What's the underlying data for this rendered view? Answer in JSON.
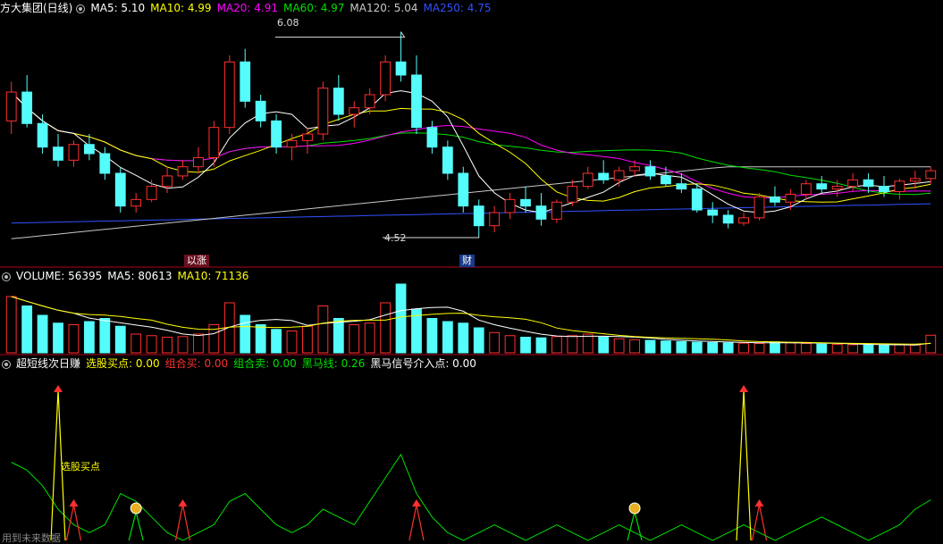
{
  "colors": {
    "bg": "#000000",
    "up": "#ff3030",
    "down": "#54fcfc",
    "ma5": "#ffffff",
    "ma10": "#ffff00",
    "ma20": "#ff00ff",
    "ma60": "#00e000",
    "ma120": "#c8c8c8",
    "ma250": "#3050ff",
    "divider": "#b00020"
  },
  "price_panel": {
    "stock_name": "方大集团(日线)",
    "ma5_label": "MA5: 5.10",
    "ma10_label": "MA10: 4.99",
    "ma20_label": "MA20: 4.91",
    "ma60_label": "MA60: 4.97",
    "ma120_label": "MA120: 5.04",
    "ma250_label": "MA250: 4.75",
    "high_label": "6.08",
    "low_label": "4.52",
    "tag_limit_up": "涨",
    "tag_limit_up_prefix": "以",
    "tag_finance": "财"
  },
  "volume_panel": {
    "vol_label": "VOLUME: 56395",
    "ma5_label": "MA5: 80613",
    "ma10_label": "MA10: 71136"
  },
  "indicator_panel": {
    "name": "超短线次日赚",
    "buy_label": "选股买点: 0.00",
    "combo_buy_label": "组合买: 0.00",
    "combo_sell_label": "组合卖: 0.00",
    "dark_horse_label": "黑马线: 0.26",
    "dark_horse_entry_label": "黑马信号介入点: 0.00",
    "annotation": "选股买点",
    "watermark": "用到未来数据"
  },
  "chart_data": [
    {
      "type": "candlestick",
      "title": "方大集团(日线)",
      "ylim": [
        4.4,
        6.2
      ],
      "high": 6.08,
      "low": 4.52,
      "ohlc": [
        [
          5.4,
          5.7,
          5.3,
          5.62
        ],
        [
          5.62,
          5.75,
          5.35,
          5.38
        ],
        [
          5.38,
          5.45,
          5.15,
          5.2
        ],
        [
          5.2,
          5.3,
          5.05,
          5.1
        ],
        [
          5.1,
          5.25,
          5.05,
          5.22
        ],
        [
          5.22,
          5.3,
          5.1,
          5.15
        ],
        [
          5.15,
          5.2,
          4.95,
          5.0
        ],
        [
          5.0,
          5.05,
          4.7,
          4.75
        ],
        [
          4.75,
          4.85,
          4.7,
          4.8
        ],
        [
          4.8,
          4.95,
          4.78,
          4.9
        ],
        [
          4.9,
          5.05,
          4.85,
          4.98
        ],
        [
          4.98,
          5.1,
          4.95,
          5.05
        ],
        [
          5.05,
          5.2,
          5.0,
          5.12
        ],
        [
          5.12,
          5.4,
          5.05,
          5.35
        ],
        [
          5.35,
          5.9,
          5.3,
          5.85
        ],
        [
          5.85,
          5.95,
          5.5,
          5.55
        ],
        [
          5.55,
          5.6,
          5.35,
          5.4
        ],
        [
          5.4,
          5.45,
          5.15,
          5.2
        ],
        [
          5.2,
          5.3,
          5.1,
          5.25
        ],
        [
          5.25,
          5.35,
          5.15,
          5.3
        ],
        [
          5.3,
          5.7,
          5.25,
          5.65
        ],
        [
          5.65,
          5.75,
          5.4,
          5.45
        ],
        [
          5.45,
          5.55,
          5.35,
          5.5
        ],
        [
          5.5,
          5.65,
          5.45,
          5.6
        ],
        [
          5.6,
          5.9,
          5.55,
          5.85
        ],
        [
          5.85,
          6.08,
          5.7,
          5.75
        ],
        [
          5.75,
          5.9,
          5.3,
          5.35
        ],
        [
          5.35,
          5.4,
          5.15,
          5.2
        ],
        [
          5.2,
          5.25,
          4.95,
          5.0
        ],
        [
          5.0,
          5.05,
          4.7,
          4.75
        ],
        [
          4.75,
          4.8,
          4.52,
          4.6
        ],
        [
          4.6,
          4.75,
          4.55,
          4.7
        ],
        [
          4.7,
          4.85,
          4.65,
          4.8
        ],
        [
          4.8,
          4.9,
          4.7,
          4.75
        ],
        [
          4.75,
          4.85,
          4.6,
          4.65
        ],
        [
          4.65,
          4.8,
          4.62,
          4.78
        ],
        [
          4.78,
          4.95,
          4.75,
          4.9
        ],
        [
          4.9,
          5.05,
          4.88,
          5.0
        ],
        [
          5.0,
          5.1,
          4.92,
          4.95
        ],
        [
          4.95,
          5.05,
          4.9,
          5.02
        ],
        [
          5.02,
          5.1,
          4.98,
          5.05
        ],
        [
          5.05,
          5.1,
          4.95,
          4.98
        ],
        [
          4.98,
          5.05,
          4.9,
          4.92
        ],
        [
          4.92,
          5.0,
          4.85,
          4.88
        ],
        [
          4.88,
          4.92,
          4.7,
          4.72
        ],
        [
          4.72,
          4.78,
          4.62,
          4.68
        ],
        [
          4.68,
          4.72,
          4.58,
          4.62
        ],
        [
          4.62,
          4.7,
          4.6,
          4.66
        ],
        [
          4.66,
          4.85,
          4.64,
          4.82
        ],
        [
          4.82,
          4.9,
          4.75,
          4.78
        ],
        [
          4.78,
          4.88,
          4.72,
          4.84
        ],
        [
          4.84,
          4.95,
          4.8,
          4.92
        ],
        [
          4.92,
          4.98,
          4.85,
          4.88
        ],
        [
          4.88,
          4.95,
          4.82,
          4.9
        ],
        [
          4.9,
          5.0,
          4.86,
          4.95
        ],
        [
          4.95,
          5.0,
          4.85,
          4.9
        ],
        [
          4.9,
          4.98,
          4.82,
          4.86
        ],
        [
          4.86,
          4.96,
          4.8,
          4.94
        ],
        [
          4.94,
          5.02,
          4.88,
          4.96
        ],
        [
          4.96,
          5.05,
          4.92,
          5.02
        ]
      ],
      "volume": [
        180000,
        150000,
        120000,
        95000,
        90000,
        100000,
        110000,
        85000,
        60000,
        55000,
        50000,
        52000,
        60000,
        90000,
        160000,
        120000,
        90000,
        75000,
        70000,
        85000,
        150000,
        110000,
        90000,
        95000,
        160000,
        220000,
        140000,
        110000,
        100000,
        95000,
        80000,
        65000,
        55000,
        50000,
        48000,
        52000,
        55000,
        60000,
        50000,
        45000,
        42000,
        40000,
        38000,
        36000,
        34000,
        33000,
        32000,
        31000,
        30000,
        35000,
        32000,
        30000,
        28000,
        27000,
        26000,
        25000,
        24000,
        26000,
        25000,
        56395
      ]
    },
    {
      "type": "line",
      "title": "超短线次日赚",
      "series": [
        {
          "name": "黑马线",
          "values": [
            0.5,
            0.45,
            0.35,
            0.2,
            0.1,
            0.05,
            0.1,
            0.3,
            0.25,
            0.15,
            0.05,
            0.0,
            0.05,
            0.1,
            0.25,
            0.3,
            0.2,
            0.1,
            0.05,
            0.1,
            0.2,
            0.15,
            0.1,
            0.25,
            0.4,
            0.55,
            0.3,
            0.15,
            0.05,
            0.0,
            0.05,
            0.1,
            0.05,
            0.0,
            0.05,
            0.1,
            0.05,
            0.0,
            0.05,
            0.1,
            0.05,
            0.0,
            0.05,
            0.1,
            0.05,
            0.0,
            0.05,
            0.1,
            0.05,
            0.0,
            0.05,
            0.1,
            0.15,
            0.1,
            0.05,
            0.0,
            0.05,
            0.1,
            0.2,
            0.26
          ]
        }
      ]
    }
  ]
}
